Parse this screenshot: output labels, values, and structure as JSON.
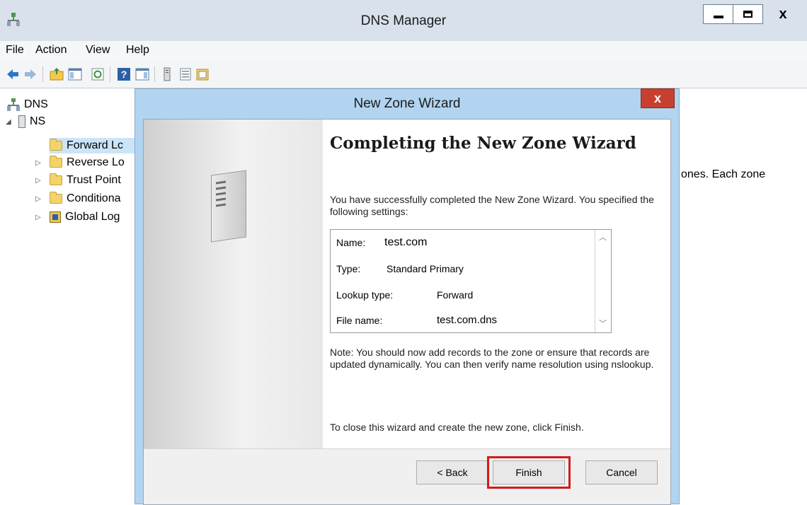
{
  "window": {
    "title": "DNS Manager",
    "close_glyph": "x"
  },
  "menubar": {
    "items": [
      "File",
      "Action",
      "View",
      "Help"
    ]
  },
  "toolbar": {
    "icons": [
      "back-arrow-icon",
      "forward-arrow-icon",
      "up-folder-icon",
      "show-hide-console-tree-icon",
      "refresh-icon",
      "help-icon",
      "action-pane-icon",
      "server-icon",
      "list-icon",
      "properties-icon"
    ]
  },
  "tree": {
    "root": "DNS",
    "server": "NS",
    "children": [
      "Forward Lc",
      "Reverse Lo",
      "Trust Point",
      "Conditiona",
      "Global Log"
    ]
  },
  "main_pane": {
    "partial_text": "ones. Each zone"
  },
  "wizard": {
    "title": "New Zone Wizard",
    "close_glyph": "x",
    "heading": "Completing the New Zone Wizard",
    "intro": "You have successfully completed the New Zone Wizard. You specified the following settings:",
    "settings": [
      {
        "label": "Name:",
        "value": "test.com"
      },
      {
        "label": "Type:",
        "value": "Standard Primary"
      },
      {
        "label": "Lookup type:",
        "value": "Forward"
      },
      {
        "label": "File name:",
        "value": "test.com.dns"
      }
    ],
    "note": "Note: You should now add records to the zone or ensure that records are updated dynamically. You can then verify name resolution using nslookup.",
    "closing": "To close this wizard and create the new zone, click Finish.",
    "buttons": {
      "back": "< Back",
      "finish": "Finish",
      "cancel": "Cancel"
    },
    "highlight_color": "#d21c1c"
  }
}
